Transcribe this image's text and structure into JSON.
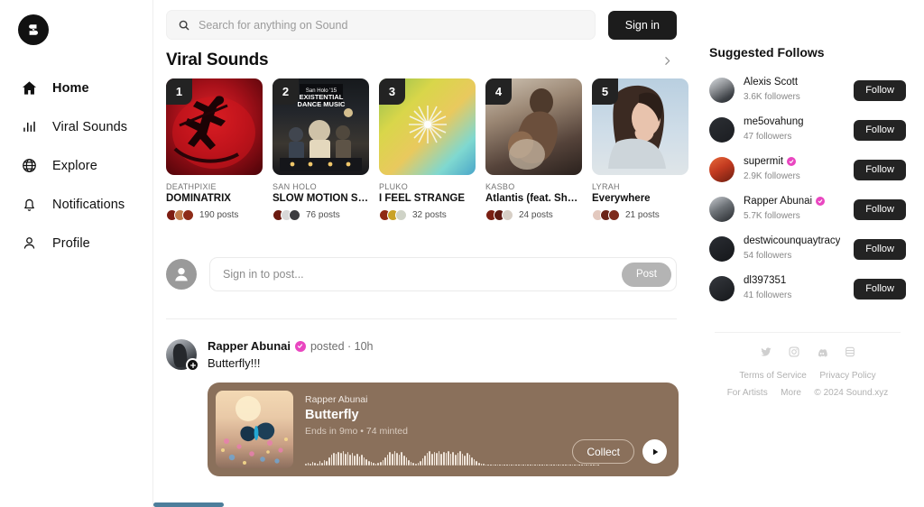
{
  "brand": {
    "name": "Sound.xyz",
    "logo_letter": "S"
  },
  "search": {
    "placeholder": "Search for anything on Sound",
    "value": "",
    "icon": "search-icon"
  },
  "header": {
    "signin_label": "Sign in"
  },
  "sidebar": {
    "items": [
      {
        "label": "Home",
        "icon": "home-icon",
        "active": true
      },
      {
        "label": "Viral Sounds",
        "icon": "bar-chart-icon",
        "active": false
      },
      {
        "label": "Explore",
        "icon": "globe-icon",
        "active": false
      },
      {
        "label": "Notifications",
        "icon": "bell-icon",
        "active": false
      },
      {
        "label": "Profile",
        "icon": "person-icon",
        "active": false
      }
    ]
  },
  "viral": {
    "title": "Viral Sounds",
    "next_icon": "chevron-right-icon",
    "cards": [
      {
        "rank": "1",
        "artist": "DEATHPIXIE",
        "title": "DOMINATRIX",
        "posts": "190 posts"
      },
      {
        "rank": "2",
        "artist": "SAN HOLO",
        "title": "SLOW MOTION SET",
        "posts": "76 posts"
      },
      {
        "rank": "3",
        "artist": "PLUKO",
        "title": "I FEEL STRANGE",
        "posts": "32 posts"
      },
      {
        "rank": "4",
        "artist": "KASBO",
        "title": "Atlantis (feat. Shallo…",
        "posts": "24 posts"
      },
      {
        "rank": "5",
        "artist": "LYRAH",
        "title": "Everywhere",
        "posts": "21 posts"
      }
    ]
  },
  "composer": {
    "placeholder": "Sign in to post...",
    "value": "",
    "post_label": "Post",
    "avatar_icon": "person-avatar-icon"
  },
  "post": {
    "author": "Rapper Abunai",
    "verified": true,
    "action": "posted · 10h",
    "text": "Butterfly!!!",
    "audio": {
      "artist": "Rapper Abunai",
      "title": "Butterfly",
      "subtitle": "Ends in 9mo • 74 minted",
      "collect_label": "Collect",
      "play_icon": "play-icon",
      "card_color": "#8a705b"
    }
  },
  "suggested": {
    "title": "Suggested Follows",
    "follow_label": "Follow",
    "users": [
      {
        "name": "Alexis Scott",
        "followers": "3.6K followers",
        "verified": false
      },
      {
        "name": "me5ovahung",
        "followers": "47 followers",
        "verified": false
      },
      {
        "name": "supermit",
        "followers": "2.9K followers",
        "verified": true
      },
      {
        "name": "Rapper Abunai",
        "followers": "5.7K followers",
        "verified": true
      },
      {
        "name": "destwicounquaytracy",
        "followers": "54 followers",
        "verified": false
      },
      {
        "name": "dl397351",
        "followers": "41 followers",
        "verified": false
      }
    ]
  },
  "footer": {
    "socials": [
      "twitter-icon",
      "instagram-icon",
      "discord-icon",
      "mirror-icon"
    ],
    "links_row1": [
      "Terms of Service",
      "Privacy Policy"
    ],
    "links_row2": [
      "For Artists",
      "More"
    ],
    "copyright": "© 2024 Sound.xyz"
  },
  "colors": {
    "accent": "#e946c0",
    "dark": "#1c1c1c",
    "audio_card": "#8a705b"
  }
}
